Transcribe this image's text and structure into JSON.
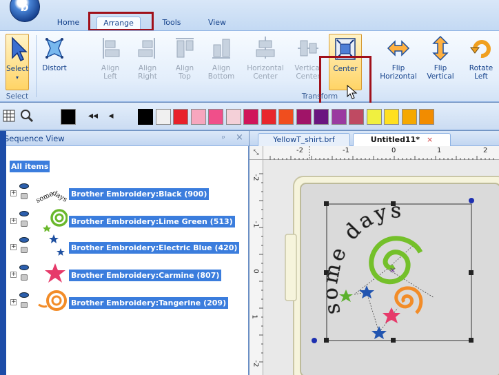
{
  "tabs": [
    "Home",
    "Arrange",
    "Tools",
    "View"
  ],
  "ribbon": {
    "select": {
      "label": "Select",
      "group": "Select"
    },
    "distort": {
      "label": "Distort"
    },
    "align_left": {
      "label": "Align\nLeft"
    },
    "align_right": {
      "label": "Align\nRight"
    },
    "align_top": {
      "label": "Align\nTop"
    },
    "align_bottom": {
      "label": "Align\nBottom"
    },
    "horizontal_center": {
      "label": "Horizontal\nCenter"
    },
    "vertical_center": {
      "label": "Vertical\nCenter"
    },
    "center": {
      "label": "Center"
    },
    "flip_horizontal": {
      "label": "Flip\nHorizontal"
    },
    "flip_vertical": {
      "label": "Flip\nVertical"
    },
    "rotate_left": {
      "label": "Rotate\nLeft"
    },
    "transform_group": "Transform"
  },
  "colors": {
    "swatches": [
      "#000000",
      "#f0f0f0",
      "#e8202a",
      "#f7a6be",
      "#f04f8a",
      "#f4d0d8",
      "#d0145a",
      "#e8262c",
      "#f04e1e",
      "#a01468",
      "#6a1480",
      "#9a3aa0",
      "#bf4a62",
      "#f0f040",
      "#ffe020",
      "#f5a800",
      "#f28c00"
    ],
    "current": "#000000",
    "accent_red": "#a0101a"
  },
  "sequence_view": {
    "title": "Sequence View",
    "pin": "ᵖ",
    "close": "×",
    "all_items": "All items",
    "items": [
      {
        "label": "Brother Embroidery:Black (900)",
        "thumb": "some-days-text-icon"
      },
      {
        "label": "Brother Embroidery:Lime Green (513)",
        "thumb": "green-spiral-icon"
      },
      {
        "label": "Brother Embroidery:Electric Blue (420)",
        "thumb": "blue-stars-icon"
      },
      {
        "label": "Brother Embroidery:Carmine (807)",
        "thumb": "pink-star-icon"
      },
      {
        "label": "Brother Embroidery:Tangerine (209)",
        "thumb": "orange-spiral-icon"
      }
    ]
  },
  "documents": {
    "tabs": [
      {
        "label": "YellowT_shirt.brf"
      },
      {
        "label": "Untitled11*",
        "close": "×"
      }
    ]
  },
  "ruler": {
    "top": [
      "-2",
      "-1",
      "0",
      "1",
      "2"
    ],
    "left": [
      "-2",
      "-1",
      "0",
      "1",
      "-2"
    ]
  },
  "design": {
    "text": "some days"
  }
}
